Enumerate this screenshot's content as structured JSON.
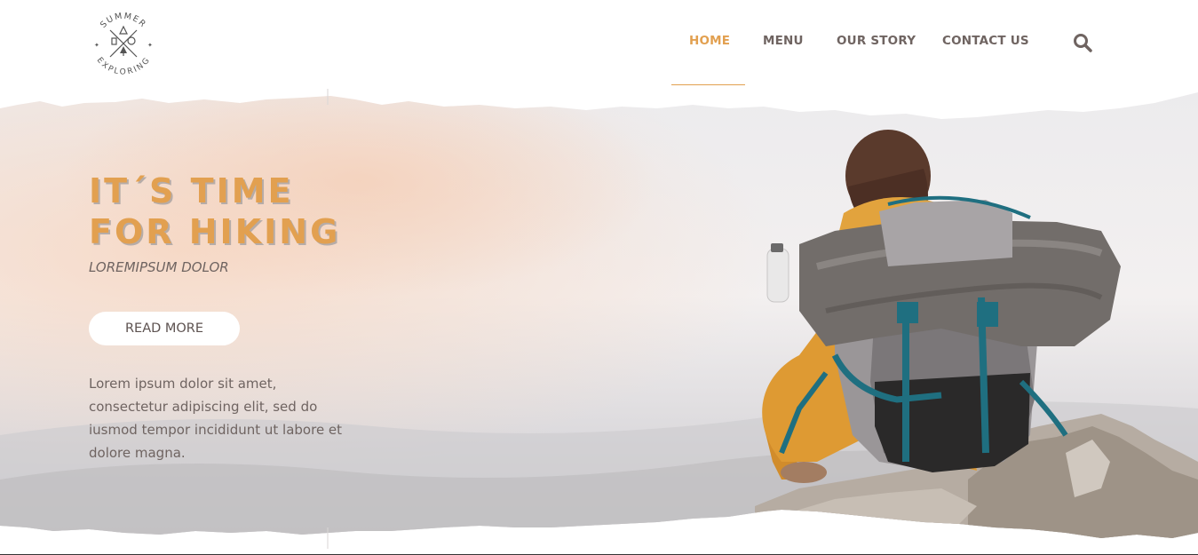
{
  "logo": {
    "top_text": "SUMMER",
    "bottom_text": "EXPLORING",
    "icon": "hiking-emblem-icon"
  },
  "nav": {
    "items": [
      {
        "label": "HOME",
        "active": true
      },
      {
        "label": "MENU",
        "active": false
      },
      {
        "label": "OUR STORY",
        "active": false
      },
      {
        "label": "CONTACT US",
        "active": false
      }
    ],
    "search_icon": "search-icon"
  },
  "hero": {
    "headline_line1": "IT´S TIME",
    "headline_line2": "FOR HIKING",
    "subtitle": "LOREMIPSUM DOLOR",
    "button_label": "READ MORE",
    "body": "Lorem ipsum dolor sit amet, consectetur adipiscing elit, sed do iusmod tempor incididunt ut labore et dolore magna.",
    "image": "hiker-with-backpack-on-mountain"
  },
  "colors": {
    "accent": "#e2a050",
    "nav_text": "#6f6461",
    "body_text": "#6f6461",
    "background": "#ffffff"
  }
}
